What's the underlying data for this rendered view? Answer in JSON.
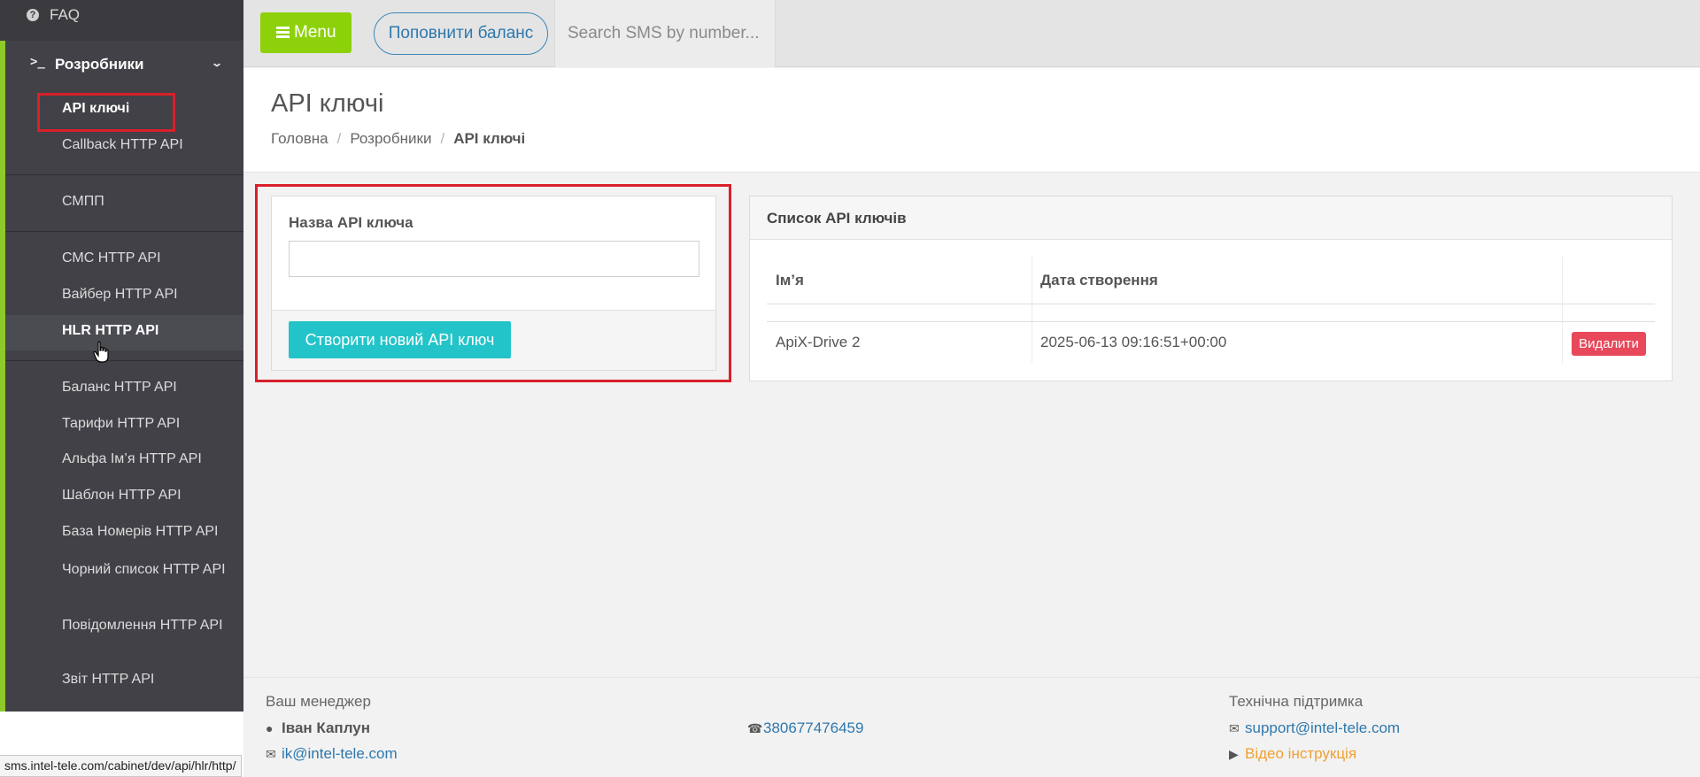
{
  "sidebar": {
    "faq_label": "FAQ",
    "group_label": "Розробники",
    "items": [
      {
        "label": "API ключі"
      },
      {
        "label": "Callback HTTP API"
      },
      {
        "label": "СМПП"
      },
      {
        "label": "СМС HTTP API"
      },
      {
        "label": "Вайбер HTTP API"
      },
      {
        "label": "HLR HTTP API"
      },
      {
        "label": "Баланс HTTP API"
      },
      {
        "label": "Тарифи HTTP API"
      },
      {
        "label": "Альфа Ім’я HTTP API"
      },
      {
        "label": "Шаблон HTTP API"
      },
      {
        "label": "База Номерів HTTP API"
      },
      {
        "label": "Чорний список HTTP API"
      },
      {
        "label": "Повідомлення HTTP API"
      },
      {
        "label": "Звіт HTTP API"
      }
    ],
    "active_item": "API ключі",
    "hover_item": "HLR HTTP API",
    "accent_color": "#8ec92a"
  },
  "topbar": {
    "menu_label": "Menu",
    "balance_label": "Поповнити баланс",
    "search_placeholder": "Search SMS by number..."
  },
  "header": {
    "title": "API ключі",
    "breadcrumb": [
      "Головна",
      "Розробники",
      "API ключі"
    ]
  },
  "create_form": {
    "field_label": "Назва API ключа",
    "field_value": "",
    "submit_label": "Створити новий API ключ"
  },
  "keys_list": {
    "title": "Список API ключів",
    "columns": [
      "Ім’я",
      "Дата створення",
      ""
    ],
    "rows": [
      {
        "name": "ApiX-Drive 2",
        "created": "2025-06-13 09:16:51+00:00",
        "action": "Видалити"
      }
    ]
  },
  "footer": {
    "manager_heading": "Ваш менеджер",
    "manager_name": "Іван Каплун",
    "manager_email": "ik@intel-tele.com",
    "manager_phone": "380677476459",
    "support_heading": "Технічна підтримка",
    "support_email": "support@intel-tele.com",
    "video_label": "Відео інструкція"
  },
  "statusbar": {
    "url": "sms.intel-tele.com/cabinet/dev/api/hlr/http/"
  }
}
